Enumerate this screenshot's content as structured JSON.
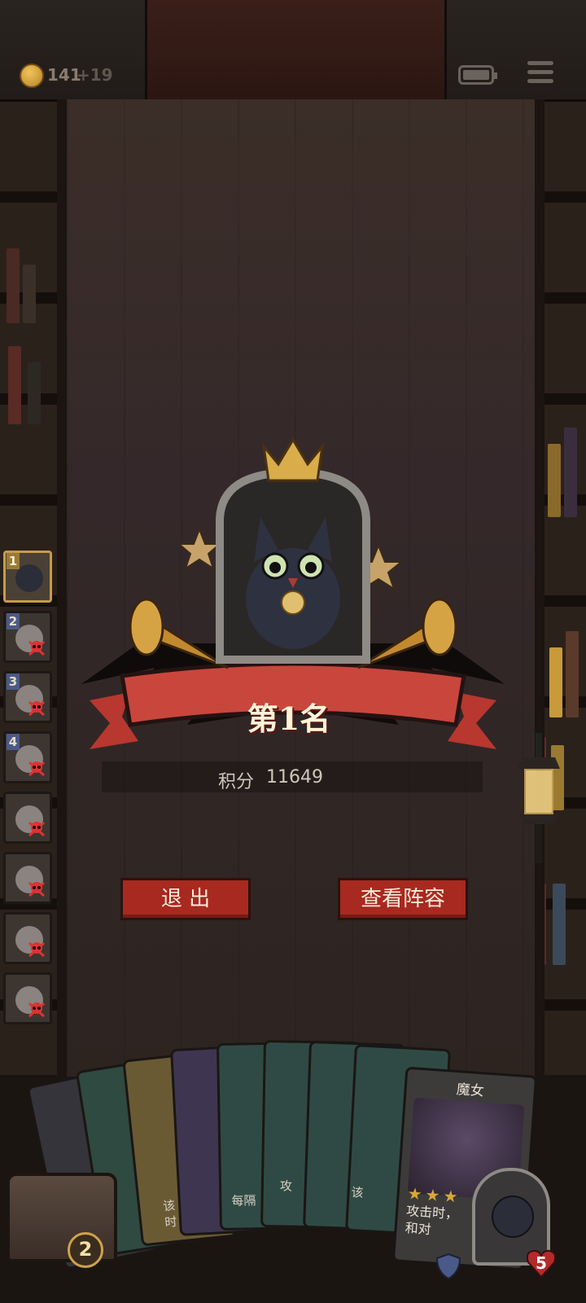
{
  "top_bar": {
    "coins": "141",
    "coin_income": "+19",
    "icons": [
      "coin-icon",
      "battery-icon",
      "menu-icon"
    ]
  },
  "players": [
    {
      "rank": "1",
      "eliminated": false
    },
    {
      "rank": "2",
      "eliminated": true
    },
    {
      "rank": "3",
      "eliminated": true
    },
    {
      "rank": "4",
      "eliminated": true
    },
    {
      "rank": "",
      "eliminated": true
    },
    {
      "rank": "",
      "eliminated": true
    },
    {
      "rank": "",
      "eliminated": true
    },
    {
      "rank": "",
      "eliminated": true
    }
  ],
  "result": {
    "rank_text": "第1名",
    "score_label": "积分",
    "score_value": "11649"
  },
  "buttons": {
    "exit": "退 出",
    "view_lineup": "查看阵容"
  },
  "hand": {
    "featured_card": {
      "name": "魔女",
      "stars": 3,
      "desc_line1": "攻击时，",
      "desc_line2": "和对"
    },
    "partial_texts": [
      "该",
      "时",
      "每隔",
      "攻",
      "该"
    ]
  },
  "bottom": {
    "deck_count": "2",
    "hp": "5"
  },
  "colors": {
    "button_red": "#a8291f",
    "banner_red": "#c9463c",
    "gold": "#d7a73a"
  }
}
